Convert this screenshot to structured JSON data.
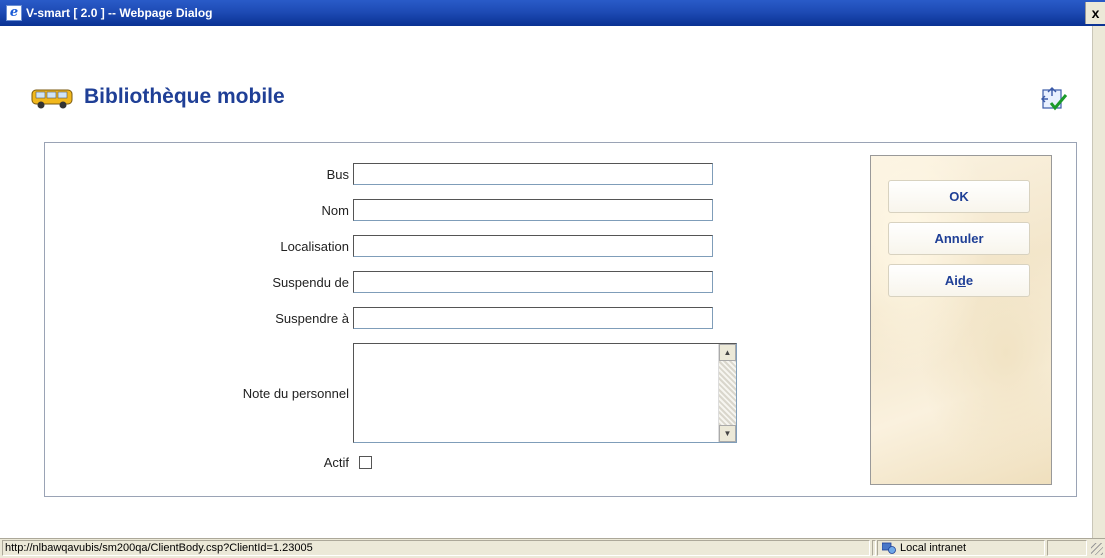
{
  "window": {
    "title": "V-smart [ 2.0 ] -- Webpage Dialog",
    "close_glyph": "x"
  },
  "page": {
    "title": "Bibliothèque mobile"
  },
  "form": {
    "fields": [
      {
        "label": "Bus",
        "value": ""
      },
      {
        "label": "Nom",
        "value": ""
      },
      {
        "label": "Localisation",
        "value": ""
      },
      {
        "label": "Suspendu de",
        "value": ""
      },
      {
        "label": "Suspendre à",
        "value": ""
      }
    ],
    "note_label": "Note du personnel",
    "note_value": "",
    "active_label": "Actif",
    "active_checked": false
  },
  "buttons": {
    "ok": "OK",
    "cancel": "Annuler",
    "help_prefix": "Ai",
    "help_underlined": "d",
    "help_suffix": "e"
  },
  "statusbar": {
    "url": "http://nlbawqavubis/sm200qa/ClientBody.csp?ClientId=1.23005",
    "zone": "Local intranet"
  },
  "colors": {
    "title_bar": "#1e4bb5",
    "heading_text": "#1f3f96",
    "panel_bg": "#f3e6cb"
  },
  "icons": {
    "window": "ie-icon",
    "heading": "bus-icon",
    "apply": "apply-checkmark-icon",
    "zone": "intranet-icon"
  }
}
